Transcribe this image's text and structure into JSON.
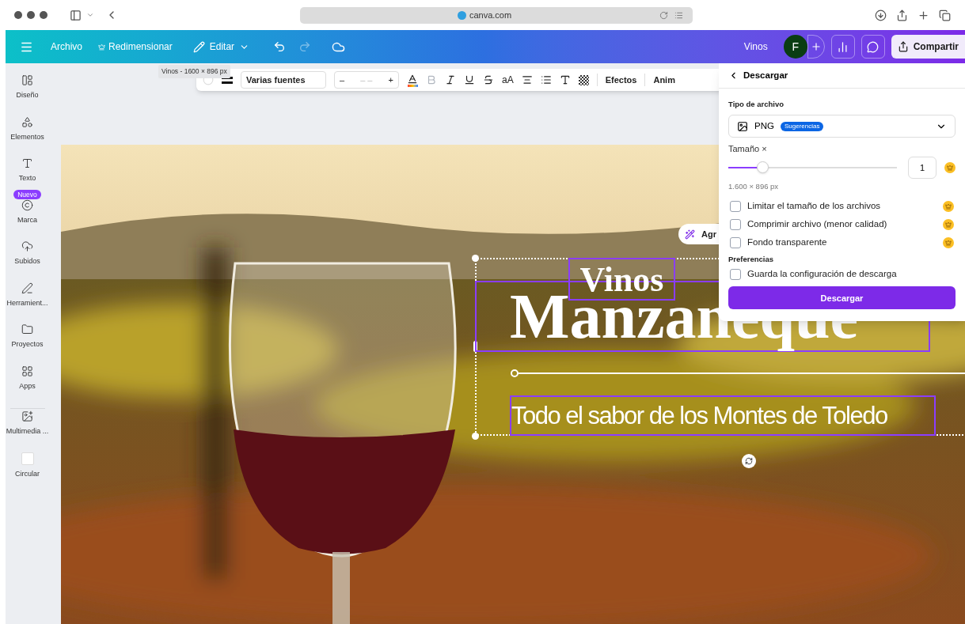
{
  "browser": {
    "url": "canva.com"
  },
  "topbar": {
    "menu": [
      {
        "label": "Archivo",
        "kind": "plain"
      },
      {
        "label": "Redimensionar",
        "kind": "crown"
      },
      {
        "label": "Editar",
        "kind": "edit"
      }
    ],
    "design_title": "Vinos",
    "avatar": "F",
    "share": "Compartir"
  },
  "tooltip": "Vinos - 1600 × 896 px",
  "text_toolbar": {
    "font": "Varias fuentes",
    "size_placeholder": "– –",
    "minus": "–",
    "plus": "+",
    "case": "aA",
    "bold_disabled": true,
    "effects": "Efectos",
    "animate": "Anim"
  },
  "sidebar": [
    {
      "label": "Diseño"
    },
    {
      "label": "Elementos"
    },
    {
      "label": "Texto"
    },
    {
      "label": "Marca",
      "badge": "Nuevo"
    },
    {
      "label": "Subidos"
    },
    {
      "label": "Herramient..."
    },
    {
      "label": "Proyectos"
    },
    {
      "label": "Apps"
    },
    {
      "label": "Multimedia ..."
    },
    {
      "label": "Circular"
    }
  ],
  "canvas": {
    "heading_small": "Vinos",
    "heading_large": "Manzaneque",
    "subtitle": "Todo el sabor de los Montes de Toledo",
    "ai_button": "Agr"
  },
  "download_panel": {
    "title": "Descargar",
    "file_type_label": "Tipo de archivo",
    "file_type": "PNG",
    "badge": "Sugerencias",
    "size_label": "Tamaño ×",
    "size": {
      "level": 0.2
    },
    "size_value": "1",
    "dimensions": "1.600 × 896 px",
    "options": [
      {
        "label": "Limitar el tamaño de los archivos",
        "checked": false,
        "premium": true
      },
      {
        "label": "Comprimir archivo (menor calidad)",
        "checked": false,
        "premium": true
      },
      {
        "label": "Fondo transparente",
        "checked": false,
        "premium": true
      }
    ],
    "preferences_label": "Preferencias",
    "preferences": [
      {
        "label": "Guarda la configuración de descarga",
        "checked": false,
        "premium": false
      }
    ],
    "button": "Descargar"
  }
}
